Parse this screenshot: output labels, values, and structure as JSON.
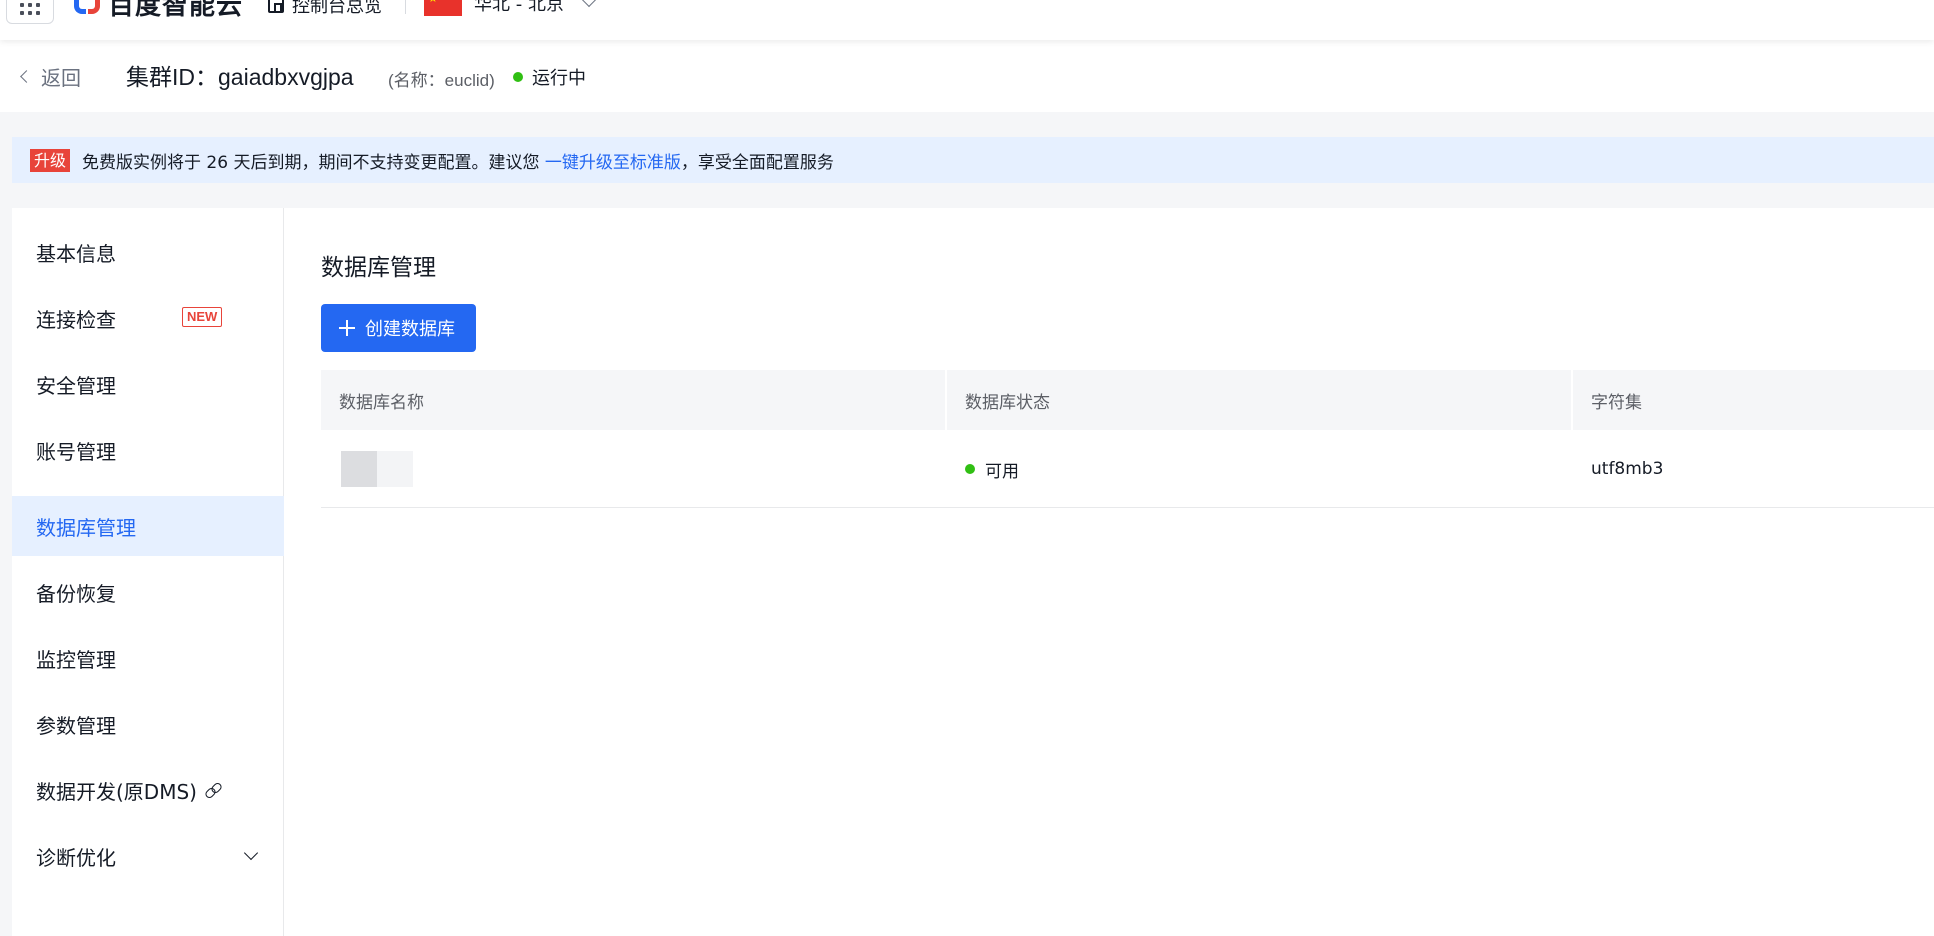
{
  "topnav": {
    "logo_text": "百度智能云",
    "console_label": "控制台总览",
    "region_label": "华北 - 北京"
  },
  "header": {
    "back_label": "返回",
    "cluster_title": "集群ID：gaiadbxvgjpa",
    "cluster_name": "(名称：euclid)",
    "status_label": "运行中"
  },
  "banner": {
    "badge": "升级",
    "text_before": "免费版实例将于 26 天后到期，期间不支持变更配置。建议您 ",
    "link": "一键升级至标准版",
    "text_after": "，享受全面配置服务"
  },
  "sidebar": {
    "items": [
      {
        "label": "基本信息"
      },
      {
        "label": "连接检查",
        "tag": "NEW"
      },
      {
        "label": "安全管理"
      },
      {
        "label": "账号管理"
      },
      {
        "label": "数据库管理",
        "active": true
      },
      {
        "label": "备份恢复"
      },
      {
        "label": "监控管理"
      },
      {
        "label": "参数管理"
      },
      {
        "label": "数据开发(原DMS)"
      },
      {
        "label": "诊断优化"
      }
    ]
  },
  "main": {
    "title": "数据库管理",
    "create_button": "创建数据库",
    "table": {
      "columns": [
        "数据库名称",
        "数据库状态",
        "字符集"
      ],
      "rows": [
        {
          "name": "",
          "status": "可用",
          "charset": "utf8mb3"
        }
      ]
    }
  },
  "colors": {
    "accent": "#2468f2",
    "danger": "#e8443a",
    "success": "#30bf13"
  }
}
